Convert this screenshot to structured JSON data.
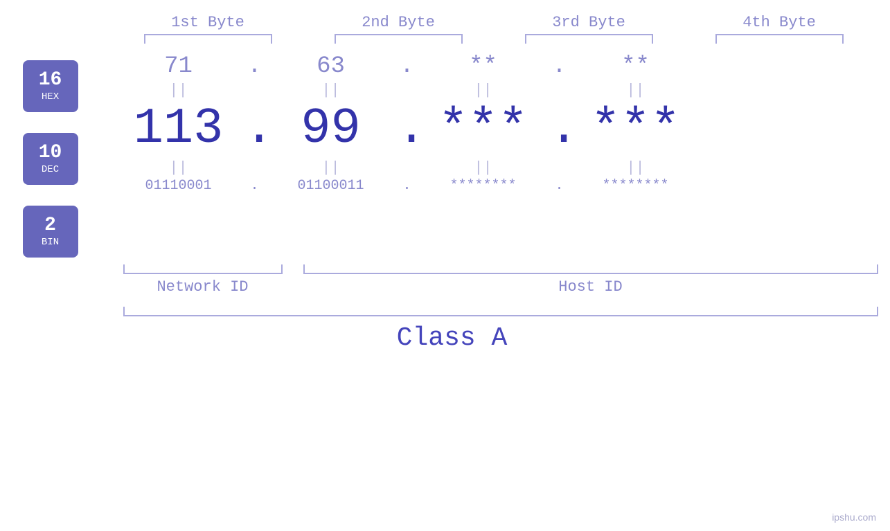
{
  "header": {
    "byte1_label": "1st Byte",
    "byte2_label": "2nd Byte",
    "byte3_label": "3rd Byte",
    "byte4_label": "4th Byte"
  },
  "badges": {
    "hex": {
      "number": "16",
      "label": "HEX"
    },
    "dec": {
      "number": "10",
      "label": "DEC"
    },
    "bin": {
      "number": "2",
      "label": "BIN"
    }
  },
  "ip": {
    "hex": [
      "71",
      "63",
      "**",
      "**"
    ],
    "dec": [
      "113.",
      "99.",
      "***.",
      "***"
    ],
    "bin": [
      "01110001.",
      "01100011.",
      "********.",
      "********"
    ],
    "dots": [
      ".",
      ".",
      ".",
      ""
    ]
  },
  "labels": {
    "network_id": "Network ID",
    "host_id": "Host ID",
    "class": "Class A"
  },
  "watermark": "ipshu.com"
}
